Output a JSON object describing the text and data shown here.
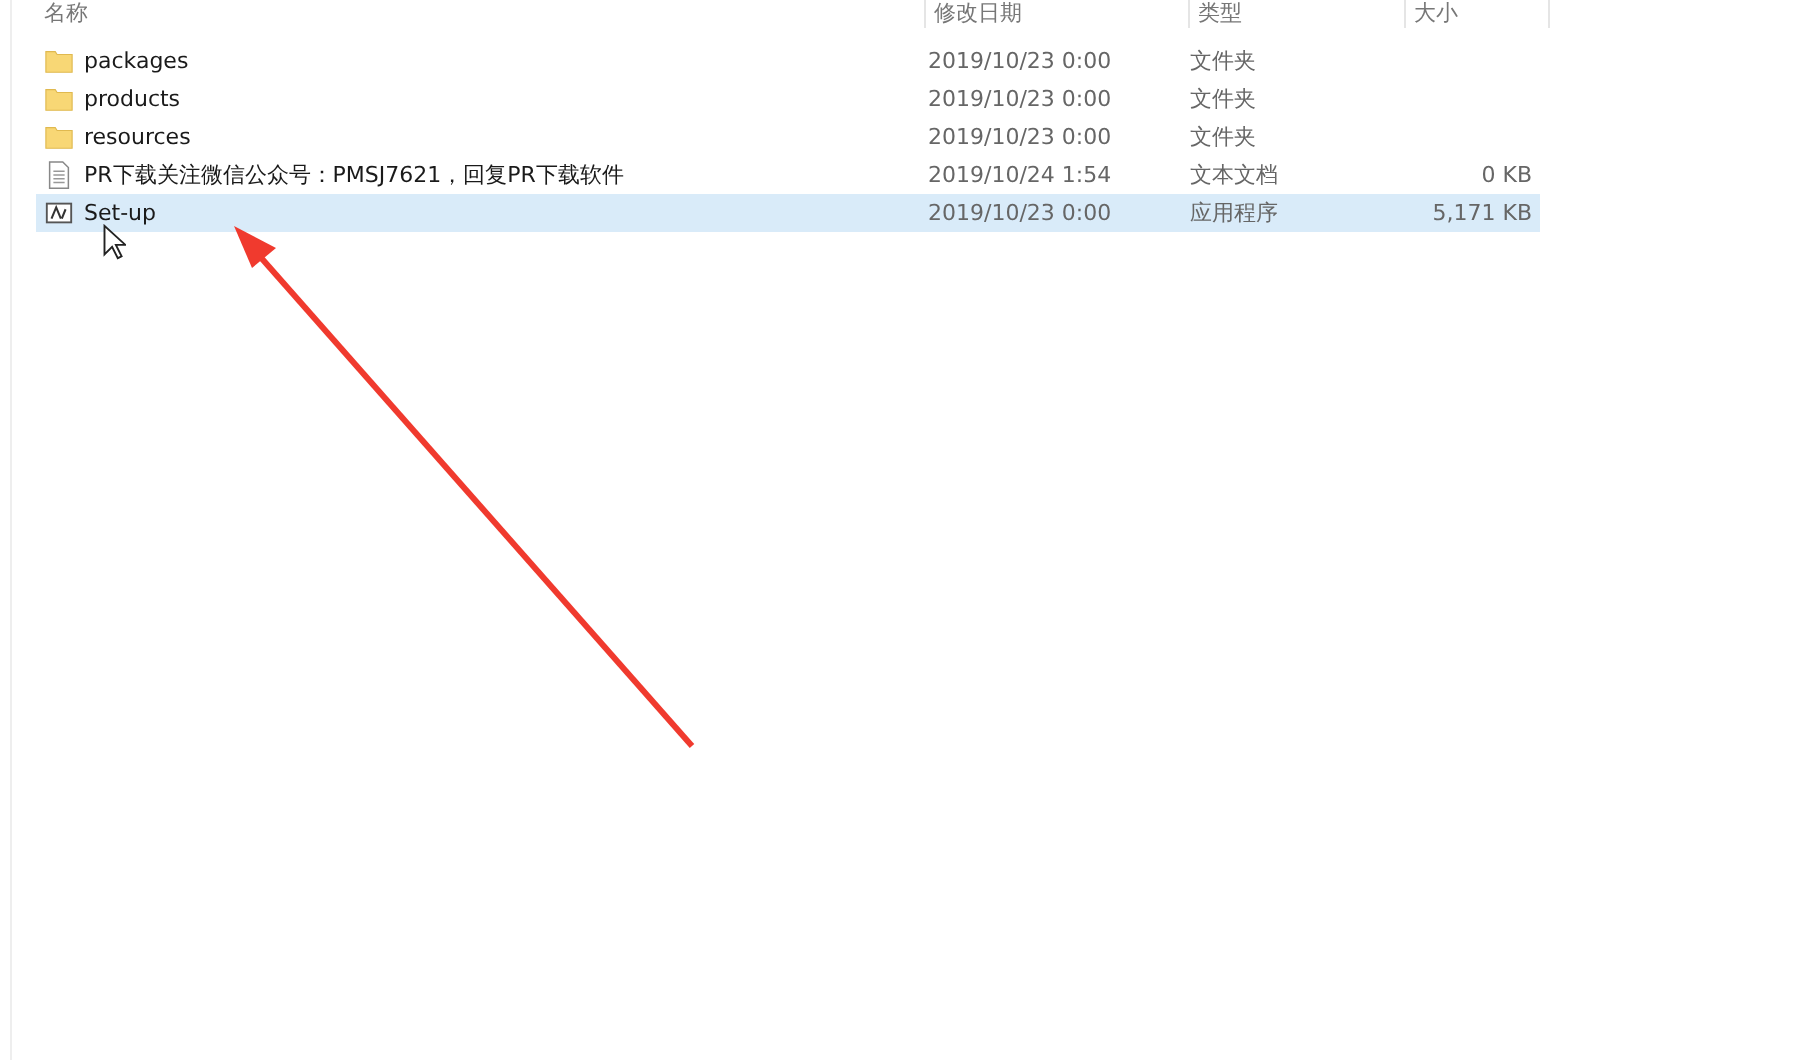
{
  "columns": [
    "名称",
    "修改日期",
    "类型",
    "大小"
  ],
  "files": [
    {
      "kind": "folder",
      "name": "packages",
      "date": "2019/10/23 0:00",
      "type": "文件夹",
      "selected": false
    },
    {
      "kind": "folder",
      "name": "products",
      "date": "2019/10/23 0:00",
      "type": "文件夹",
      "selected": false
    },
    {
      "kind": "folder",
      "name": "resources",
      "date": "2019/10/23 0:00",
      "type": "文件夹",
      "selected": false
    },
    {
      "kind": "text",
      "name": "PR下载关注微信公众号：PMSJ7621，回复PR下载软件",
      "date": "2019/10/24 1:54",
      "type": "文本文档",
      "size": "0 KB",
      "selected": false
    },
    {
      "kind": "app",
      "name": "Set-up",
      "date": "2019/10/23 0:00",
      "type": "应用程序",
      "size": "5,171 KB",
      "selected": true
    }
  ]
}
